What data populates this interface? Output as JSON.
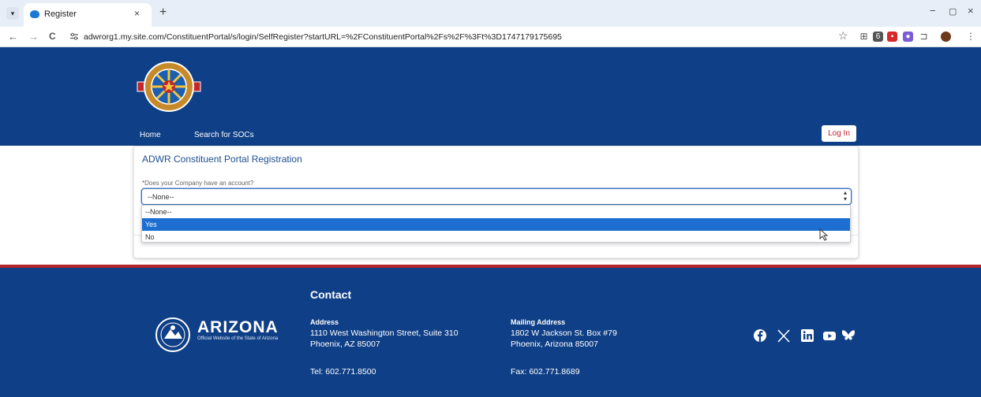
{
  "browser": {
    "tab_title": "Register",
    "tab_close": "×",
    "new_tab": "+",
    "url": "adwrorg1.my.site.com/ConstituentPortal/s/login/SelfRegister?startURL=%2FConstituentPortal%2Fs%2F%3Ft%3D1747179175695",
    "back": "←",
    "forward": "→",
    "reload": "C",
    "site_info_icon": "tune-icon",
    "star": "☆",
    "window_minimize": "−",
    "window_restore": "▢",
    "window_close": "×"
  },
  "header": {
    "login_label": "Log In",
    "nav": [
      "Home",
      "Search for SOCs"
    ],
    "colors": {
      "navy": "#0f3f86",
      "red": "#c1272d"
    }
  },
  "form": {
    "title": "ADWR Constituent Portal Registration",
    "required_mark": "*",
    "field_label": "Does your Company have an account?",
    "selected_value": "--None--",
    "options": [
      "--None--",
      "Yes",
      "No"
    ],
    "highlighted_option": "Yes"
  },
  "footer": {
    "contact_heading": "Contact",
    "brand_name": "ARIZONA",
    "brand_tagline": "Official Website of the State of Arizona",
    "address": {
      "heading": "Address",
      "line1": "1110 West Washington Street, Suite 310",
      "line2": "Phoenix, AZ 85007",
      "tel": "Tel: 602.771.8500"
    },
    "mailing": {
      "heading": "Mailing Address",
      "line1": "1802 W Jackson St. Box #79",
      "line2": "Phoenix, Arizona 85007",
      "fax": "Fax: 602.771.8689"
    },
    "social_icons": [
      "facebook-icon",
      "x-icon",
      "linkedin-icon",
      "youtube-icon",
      "bluesky-icon"
    ]
  }
}
